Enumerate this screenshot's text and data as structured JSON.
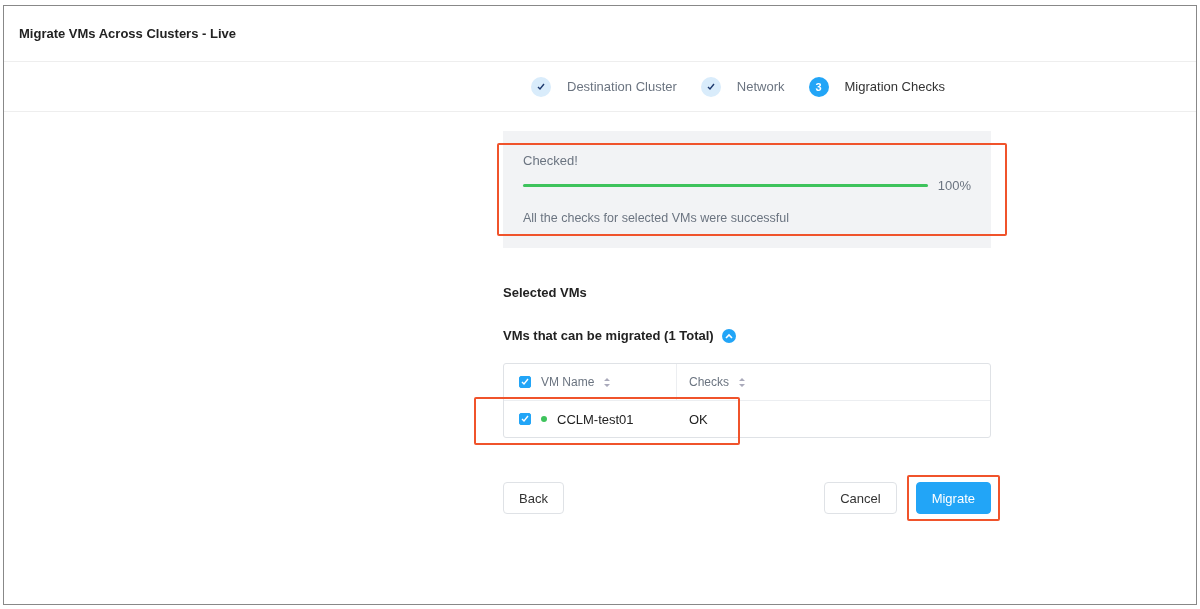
{
  "window": {
    "title": "Migrate VMs Across Clusters - Live"
  },
  "steps": [
    {
      "label": "Destination Cluster",
      "kind": "done"
    },
    {
      "label": "Network",
      "kind": "done"
    },
    {
      "label": "Migration Checks",
      "kind": "current",
      "number": "3"
    }
  ],
  "progress": {
    "status": "Checked!",
    "level": 1,
    "reading": "100%",
    "message": "All the checks for selected VMs were successful",
    "highlighted": true
  },
  "selected_heading": "Selected VMs",
  "group": {
    "title": "VMs that can be migrated (1 Total)",
    "expanded": true
  },
  "table": {
    "all_checked": true,
    "columns": [
      "VM Name",
      "Checks"
    ],
    "rows": [
      {
        "checked": true,
        "color": "#3ec35c",
        "name": "CCLM-test01",
        "checks": "OK",
        "highlighted": true
      }
    ]
  },
  "buttons": [
    {
      "label": "Back",
      "kind": "secondary",
      "highlighted": false
    },
    {
      "label": "Cancel",
      "kind": "secondary",
      "highlighted": false
    },
    {
      "label": "Migrate",
      "kind": "primary",
      "highlighted": true
    }
  ]
}
